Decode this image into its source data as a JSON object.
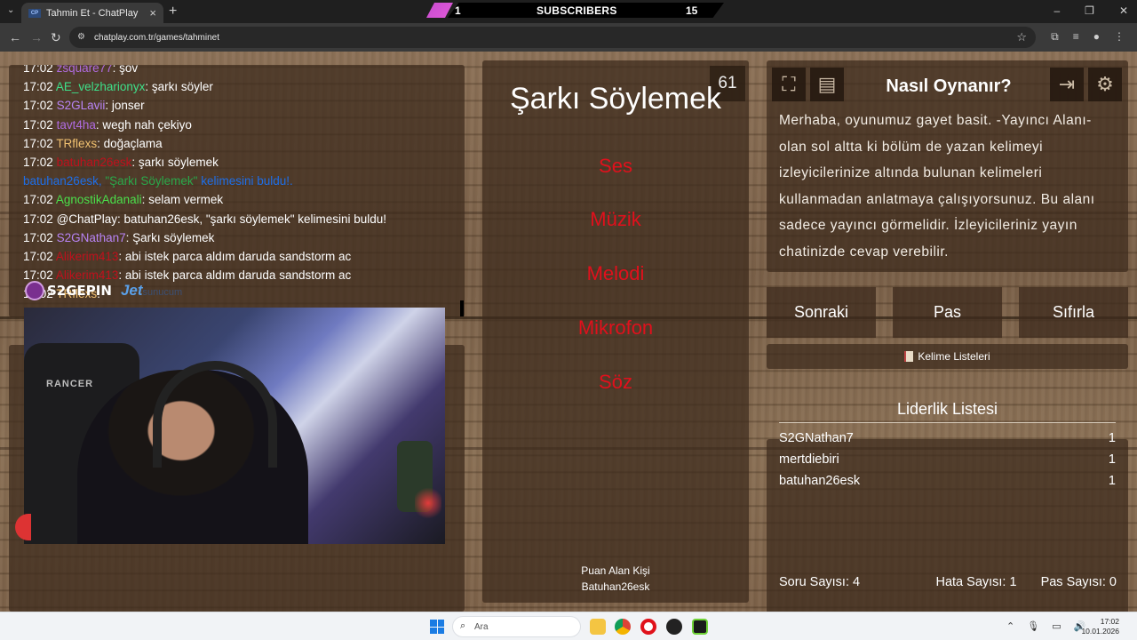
{
  "browser": {
    "tab_title": "Tahmin Et - ChatPlay",
    "tab_favicon_text": "CP",
    "url": "chatplay.com.tr/games/tahminet"
  },
  "subscribers_bar": {
    "left_count": "1",
    "label": "SUBSCRIBERS",
    "right_count": "15"
  },
  "chat": {
    "messages": [
      {
        "time": "17:02",
        "user": "zsquare77",
        "user_color": "#b06be0",
        "text": ": şov"
      },
      {
        "time": "17:02",
        "user": "AE_velzharionyx",
        "user_color": "#3ee08a",
        "text": ": şarkı söyler"
      },
      {
        "time": "17:02",
        "user": "S2GLavii",
        "user_color": "#b884f5",
        "text": ": jonser"
      },
      {
        "time": "17:02",
        "user": "tavt4ha",
        "user_color": "#b06be0",
        "text": ": wegh nah çekiyo"
      },
      {
        "time": "17:02",
        "user": "TRflexs",
        "user_color": "#f0c070",
        "text": ": doğaçlama"
      },
      {
        "time": "17:02",
        "user": "batuhan26esk",
        "user_color": "#c0101c",
        "text": ": şarkı söylemek"
      },
      {
        "time": "",
        "user": "batuhan26esk, ",
        "user_color": "#1e6ee8",
        "text": "\"Şarkı Söylemek\" kelimesini buldu!.",
        "text_color": "#1e6ee8",
        "highlight": "\"Şarkı Söylemek\"",
        "highlight_color": "#2aa84a"
      },
      {
        "time": "17:02",
        "user": "AgnostikAdanali",
        "user_color": "#4be04b",
        "text": ": selam vermek"
      },
      {
        "time": "17:02",
        "user": "@ChatPlay",
        "user_color": "#ffffff",
        "text": ": batuhan26esk, \"şarkı söylemek\" kelimesini buldu!"
      },
      {
        "time": "17:02",
        "user": "S2GNathan7",
        "user_color": "#b884f5",
        "text": ": Şarkı söylemek"
      },
      {
        "time": "17:02",
        "user": "Alikerim413",
        "user_color": "#c0101c",
        "text": ": abi istek parca aldım daruda sandstorm ac"
      },
      {
        "time": "17:02",
        "user": "Alikerim413",
        "user_color": "#c0101c",
        "text": ": abi istek parca aldım daruda sandstorm ac"
      },
      {
        "time": "17:02",
        "user": "TRflexs",
        "user_color": "#f0c070",
        "text": ": "
      }
    ]
  },
  "logos": {
    "brand1": "S2GEPIN",
    "brand2": "Jet",
    "brand2_sub": "sunucum"
  },
  "webcam": {
    "chair_text": "RANCER"
  },
  "game": {
    "timer": "61",
    "word": "Şarkı Söylemek",
    "forbidden": [
      "Ses",
      "Müzik",
      "Melodi",
      "Mikrofon",
      "Söz"
    ],
    "scorer_label": "Puan Alan Kişi",
    "scorer_name": "Batuhan26esk"
  },
  "howto": {
    "title": "Nasıl Oynanır?",
    "text": "Merhaba, oyunumuz gayet basit. -Yayıncı Alanı- olan sol altta ki bölüm de yazan kelimeyi izleyicilerinize altında bulunan kelimeleri kullanmadan anlatmaya çalışıyorsunuz. Bu alanı sadece yayıncı görmelidir. İzleyicileriniz yayın chatinizde cevap verebilir."
  },
  "actions": {
    "next": "Sonraki",
    "pass": "Pas",
    "reset": "Sıfırla",
    "word_lists": "Kelime Listeleri"
  },
  "leaderboard": {
    "title": "Liderlik Listesi",
    "rows": [
      {
        "name": "S2GNathan7",
        "score": "1"
      },
      {
        "name": "mertdiebiri",
        "score": "1"
      },
      {
        "name": "batuhan26esk",
        "score": "1"
      }
    ]
  },
  "stats": {
    "questions": "Soru Sayısı: 4",
    "errors": "Hata Sayısı: 1",
    "passes": "Pas Sayısı: 0"
  },
  "taskbar": {
    "search_placeholder": "Ara",
    "time": "17:02",
    "date": "10.01.2026"
  }
}
